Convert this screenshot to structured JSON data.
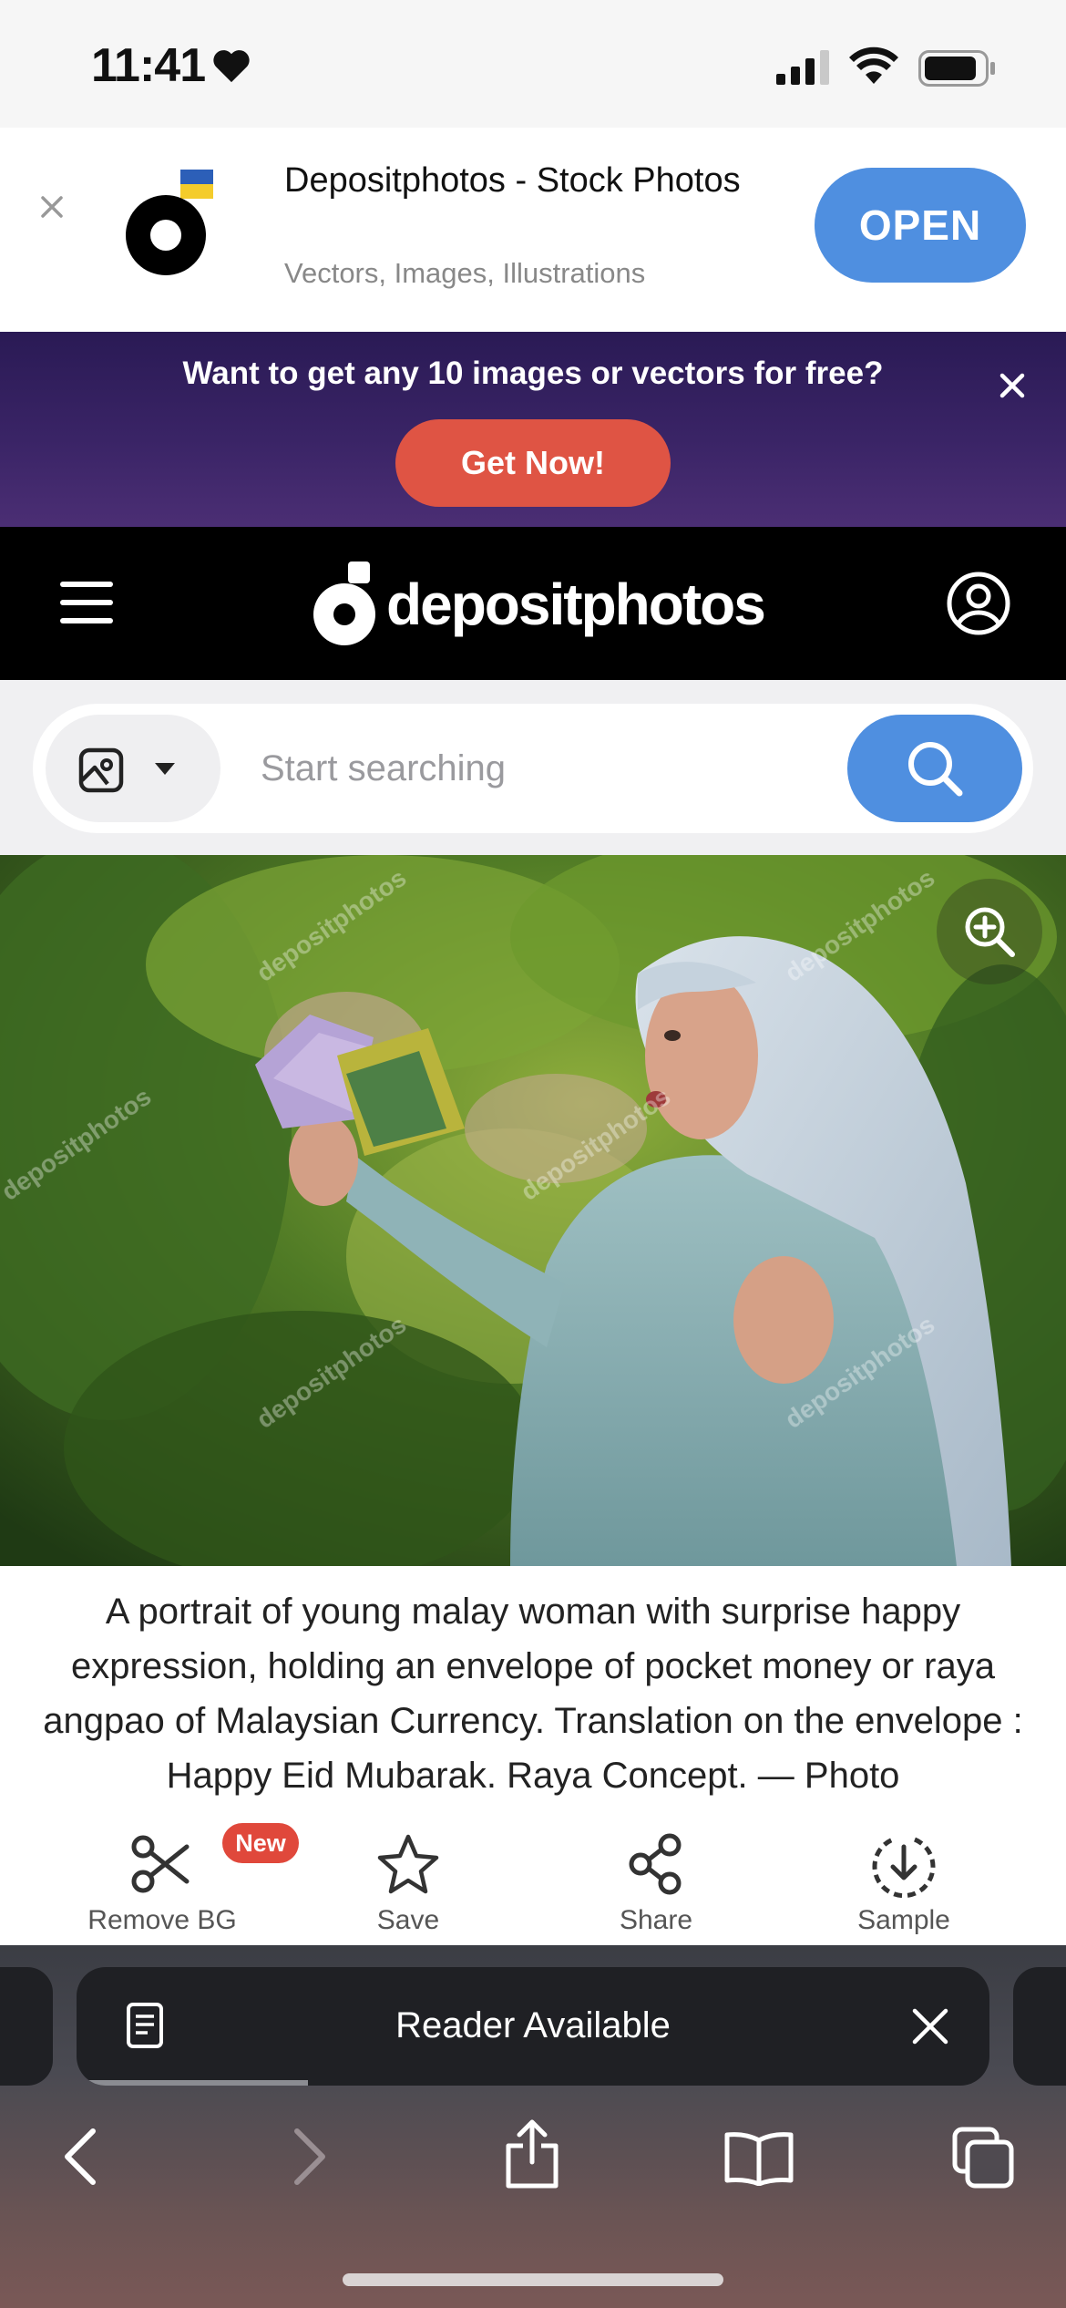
{
  "status_bar": {
    "time": "11:41"
  },
  "app_banner": {
    "app_name": "Depositphotos - Stock Photos",
    "subtitle": "Vectors, Images, Illustrations",
    "open_label": "OPEN"
  },
  "promo": {
    "text": "Want to get any 10 images or vectors for free?",
    "cta_label": "Get Now!"
  },
  "header": {
    "logo_text": "depositphotos"
  },
  "search": {
    "placeholder": "Start searching",
    "value": ""
  },
  "photo": {
    "description": "A portrait of young malay woman with surprise happy expression, holding an envelope of pocket money or raya angpao of Malaysian Currency. Translation on the envelope : Happy Eid Mubarak. Raya Concept. — Photo",
    "watermark": "depositphotos"
  },
  "actions": [
    {
      "label": "Remove BG",
      "icon": "scissors-icon",
      "badge": "New"
    },
    {
      "label": "Save",
      "icon": "star-icon"
    },
    {
      "label": "Share",
      "icon": "share-icon"
    },
    {
      "label": "Sample",
      "icon": "download-icon"
    }
  ],
  "safari": {
    "reader_text": "Reader Available"
  },
  "colors": {
    "accent": "#4f8fe0",
    "promo_bg": "#2a1a55",
    "cta": "#df5444",
    "badge": "#e0483b"
  }
}
